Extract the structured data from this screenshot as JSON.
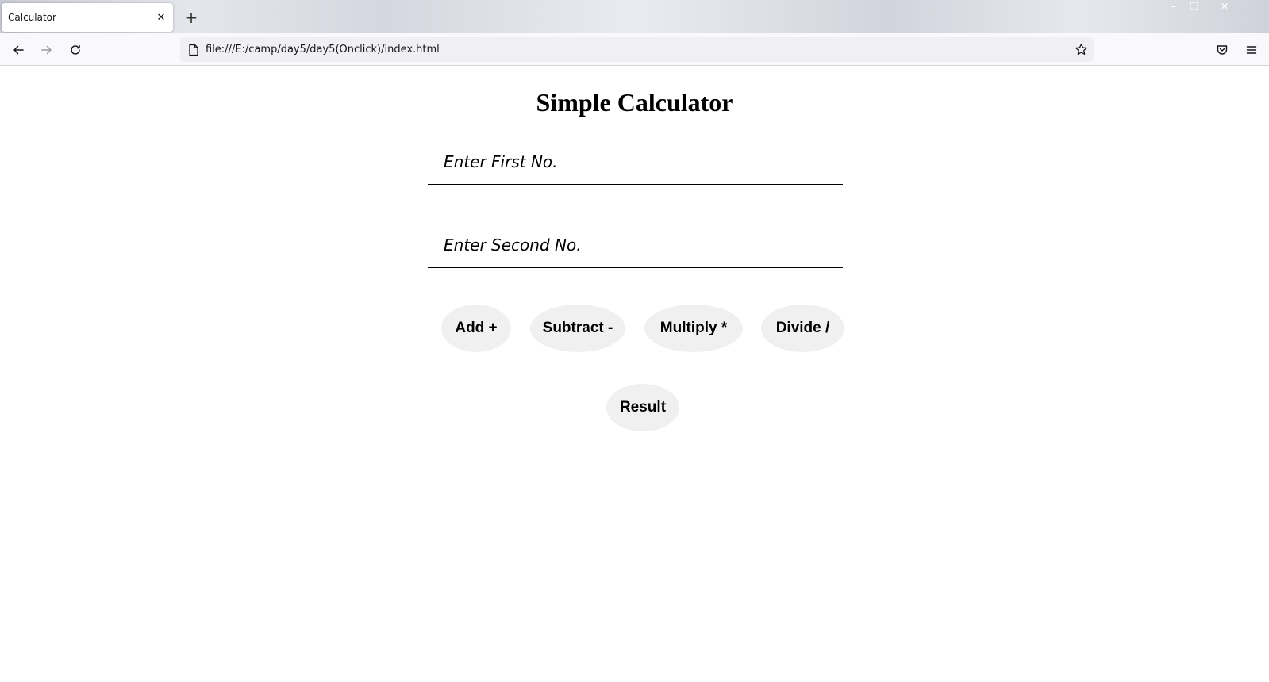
{
  "browser": {
    "tab_title": "Calculator",
    "tab_close": "✕",
    "new_tab": "+",
    "url": "file:///E:/camp/day5/day5(Onclick)/index.html",
    "window_controls": {
      "minimize": "–",
      "restore": "❐",
      "close": "✕"
    },
    "icons": [
      "back-arrow-icon",
      "forward-arrow-icon",
      "reload-icon",
      "page-icon",
      "bookmark-star-icon",
      "pocket-icon",
      "menu-icon"
    ]
  },
  "page": {
    "title": "Simple Calculator",
    "first_input": {
      "placeholder": "Enter First No.",
      "value": ""
    },
    "second_input": {
      "placeholder": "Enter Second No.",
      "value": ""
    },
    "buttons": {
      "add": "Add +",
      "subtract": "Subtract -",
      "multiply": "Multiply *",
      "divide": "Divide /",
      "result": "Result"
    }
  },
  "colors": {
    "button_bg": "#f0f0f0",
    "toolbar_bg": "#f9f9fb",
    "urlbar_bg": "#f0f0f4"
  }
}
